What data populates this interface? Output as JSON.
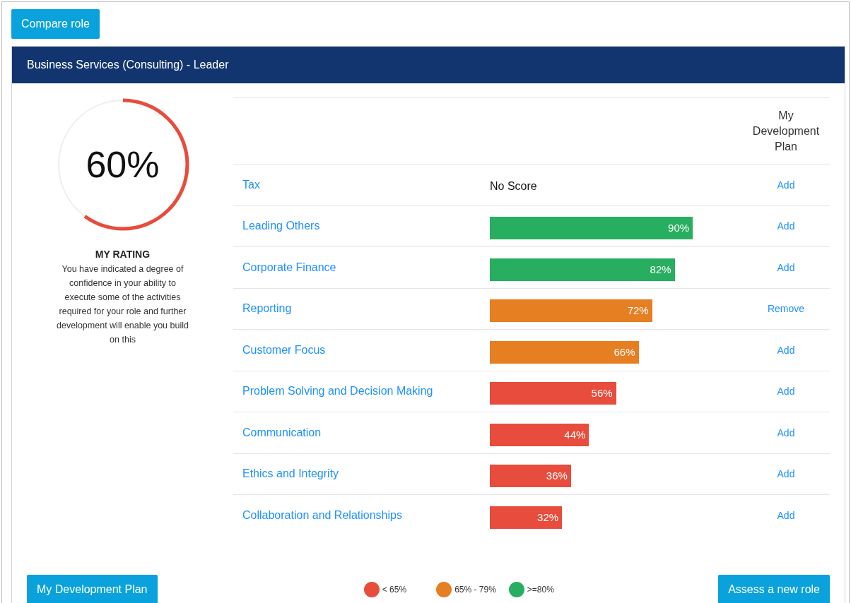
{
  "compare_button": "Compare role",
  "card": {
    "title": "Business Services (Consulting) - Leader"
  },
  "rating": {
    "value": "60%",
    "level": 0.6,
    "heading": "MY RATING",
    "description": "You have indicated a degree of confidence in your ability to execute some of the activities required for your role and further development will enable you build on this"
  },
  "table": {
    "columns": [
      "My Development Plan"
    ],
    "rows": [
      {
        "name": "Tax",
        "kind": "none",
        "reading": "No Score",
        "action": "Add"
      },
      {
        "name": "Leading Others",
        "kind": "score",
        "reading": "90%",
        "color": "#27ae60",
        "action": "Add"
      },
      {
        "name": "Corporate Finance",
        "kind": "score",
        "reading": "82%",
        "color": "#27ae60",
        "action": "Add"
      },
      {
        "name": "Reporting",
        "kind": "score",
        "reading": "72%",
        "color": "#e67e22",
        "action": "Remove"
      },
      {
        "name": "Customer Focus",
        "kind": "score",
        "reading": "66%",
        "color": "#e67e22",
        "action": "Add"
      },
      {
        "name": "Problem Solving and Decision Making",
        "kind": "score",
        "reading": "56%",
        "color": "#e74c3c",
        "action": "Add"
      },
      {
        "name": "Communication",
        "kind": "score",
        "reading": "44%",
        "color": "#e74c3c",
        "action": "Add"
      },
      {
        "name": "Ethics and Integrity",
        "kind": "score",
        "reading": "36%",
        "color": "#e74c3c",
        "action": "Add"
      },
      {
        "name": "Collaboration and Relationships",
        "kind": "score",
        "reading": "32%",
        "color": "#e74c3c",
        "action": "Add"
      }
    ]
  },
  "footer": {
    "plan_button": "My Development Plan",
    "legend": [
      {
        "label": "< 65%",
        "color": "#e74c3c"
      },
      {
        "label": "65% - 79%",
        "color": "#e67e22"
      },
      {
        "label": ">=80%",
        "color": "#27ae60"
      }
    ],
    "assess_button": "Assess a new role"
  }
}
